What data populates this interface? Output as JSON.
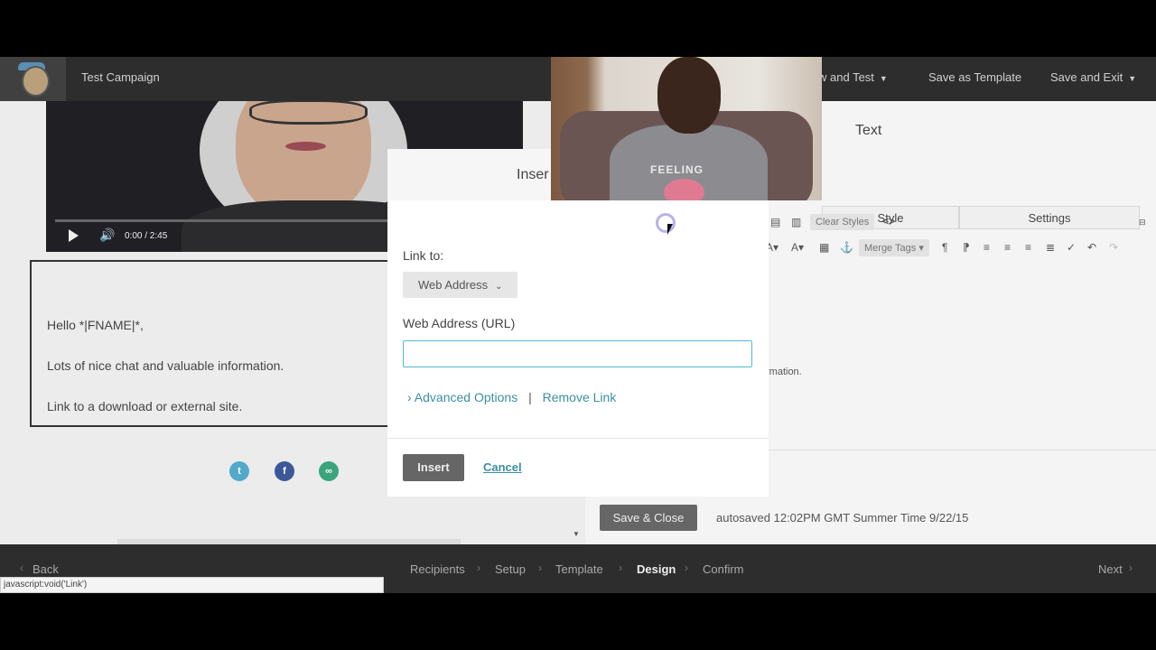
{
  "app": {
    "campaign_name": "Test Campaign",
    "menu": {
      "preview": "w and Test",
      "save_template": "Save as Template",
      "save_exit": "Save and Exit"
    }
  },
  "preview": {
    "video_time": "0:00 / 2:45",
    "body_lines": [
      "Hello *|FNAME|*,",
      "Lots of nice chat and valuable information.",
      "Link to a download or external site."
    ],
    "social_icons": [
      "twitter-icon",
      "facebook-icon",
      "link-icon"
    ]
  },
  "editor": {
    "title": "Text",
    "tabs": [
      "Style",
      "Settings"
    ],
    "toolbar": {
      "clear_styles": "Clear Styles",
      "merge_tags": "Merge Tags"
    },
    "excerpt": "rmation.",
    "save_close": "Save & Close",
    "autosaved": "autosaved 12:02PM GMT Summer Time 9/22/15"
  },
  "dialog": {
    "title": "Inser",
    "link_to_label": "Link to:",
    "link_type": "Web Address",
    "url_label": "Web Address (URL)",
    "url_value": "",
    "advanced_options": "Advanced Options",
    "remove_link": "Remove Link",
    "insert": "Insert",
    "cancel": "Cancel"
  },
  "webcam": {
    "shirt_text": "FEELING"
  },
  "steps": {
    "back": "Back",
    "items": [
      "Recipients",
      "Setup",
      "Template",
      "Design",
      "Confirm"
    ],
    "active": "Design",
    "next": "Next"
  },
  "status_url": "javascript:void('Link')",
  "colors": {
    "accent": "#52bad5",
    "link": "#3c8ea3",
    "twitter": "#52a9c9",
    "facebook": "#3b5998",
    "link_icon": "#3aa57c"
  }
}
